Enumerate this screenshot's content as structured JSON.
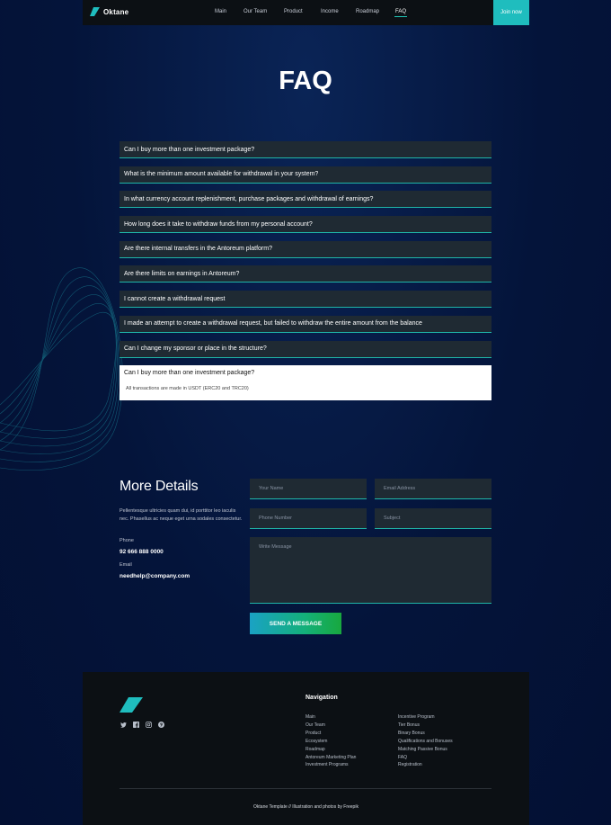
{
  "header": {
    "logo_text": "Oktane",
    "nav": [
      "Main",
      "Our Team",
      "Product",
      "Income",
      "Roadmap",
      "FAQ"
    ],
    "active": "FAQ",
    "join_label": "Join now"
  },
  "title": "FAQ",
  "faq": {
    "questions": [
      "Can I buy more than one investment package?",
      "What is the minimum amount available for withdrawal in your system?",
      "In what currency account replenishment, purchase packages and withdrawal of earnings?",
      "How long does it take to withdraw funds from my personal account?",
      "Are there internal transfers in the Antoreum platform?",
      "Are there limits on earnings in Antoreum?",
      "I cannot create a withdrawal request",
      "I made an attempt to create a withdrawal request, but failed to withdraw the entire amount from the balance",
      "Can I change my sponsor or place in the structure?"
    ],
    "open": {
      "question": "Can I buy more than one investment package?",
      "answer": "All transactions are made in USDT (ERC20 and TRC20)"
    }
  },
  "details": {
    "heading": "More Details",
    "text": "Pellentesque ultricies quam dui, id porttitor leo iaculis nec. Phasellus ac neque eget urna sodales consectetur.",
    "phone_label": "Phone",
    "phone": "92 666 888 0000",
    "email_label": "Email",
    "email": "needhelp@company.com"
  },
  "form": {
    "name_placeholder": "Your Name",
    "email_placeholder": "Email Address",
    "phone_placeholder": "Phone Number",
    "subject_placeholder": "Subject",
    "message_placeholder": "Write Message",
    "send_label": "SEND A MESSAGE"
  },
  "footer": {
    "nav_title": "Navigation",
    "col1": [
      "Main",
      "Our Team",
      "Product",
      "Ecosystem",
      "Roadmap",
      "Antoreum Marketing Plan",
      "Investment Programs"
    ],
    "col2": [
      "Incentive Program",
      "Tier Bonus",
      "Binary Bonus",
      "Qualifications and Bonuses",
      "Matching Passive Bonus",
      "FAQ",
      "Registration"
    ],
    "socials": [
      "twitter-icon",
      "facebook-icon",
      "instagram-icon",
      "pinterest-icon"
    ],
    "copyright": "Oktane Template // Illustration and photos by Freepik"
  },
  "colors": {
    "background": "#04143a",
    "accent": "#1fbdbe",
    "panel": "#1f2a33",
    "footer": "#0c1014"
  }
}
